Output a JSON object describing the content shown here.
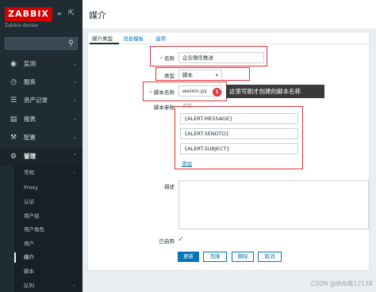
{
  "sidebar": {
    "logo": "ZABBIX",
    "subtitle": "Zabbix docker",
    "collapse_icon": "«",
    "kiosk_icon": "⇱",
    "search_placeholder": "",
    "menu": [
      {
        "icon": "eye-icon",
        "label": "监测"
      },
      {
        "icon": "clock-icon",
        "label": "服务"
      },
      {
        "icon": "list-icon",
        "label": "资产记录"
      },
      {
        "icon": "bar-chart-icon",
        "label": "报表"
      },
      {
        "icon": "wrench-icon",
        "label": "配置"
      },
      {
        "icon": "gear-icon",
        "label": "管理"
      }
    ],
    "submenu": [
      "常规",
      "Proxy",
      "认证",
      "用户组",
      "用户角色",
      "用户",
      "媒介",
      "脚本",
      "队列"
    ],
    "selected_submenu": "媒介"
  },
  "header": {
    "title": "媒介"
  },
  "tabs": [
    "媒介类型",
    "消息模板",
    "选项"
  ],
  "form": {
    "name_label": "名称",
    "name_value": "企业微信推送",
    "type_label": "类型",
    "type_value": "脚本",
    "script_label": "脚本名称",
    "script_value": "weixin.py",
    "params_label": "脚本参数",
    "params_header": "参数",
    "params": [
      "{ALERT.MESSAGE}",
      "{ALERT.SENDTO}",
      "{ALERT.SUBJECT}"
    ],
    "add_link": "添加",
    "description_label": "描述",
    "enabled_label": "已启用",
    "enabled": true
  },
  "annotation": {
    "badge": "1",
    "callout": "这里写刚才创建的脚本名称"
  },
  "buttons": {
    "update": "更新",
    "clone": "克隆",
    "delete": "删除",
    "cancel": "取消"
  },
  "watermark": "CSDN @帆布鞋12138",
  "colors": {
    "sidebar": "#1f2c33",
    "logo": "#d40000",
    "accent": "#0275b8",
    "annotation": "#e3353d"
  }
}
